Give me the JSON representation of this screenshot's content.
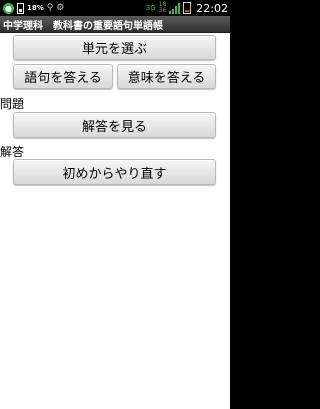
{
  "status_bar": {
    "left_icons": [
      "app-icon",
      "battery-small-icon",
      "usb-icon",
      "android-debug-icon"
    ],
    "battery_small_percent": "18%",
    "network_label": "3G",
    "signal_level_top": "18",
    "signal_level_bottom": "36",
    "time": "22:02"
  },
  "title": "中学理科　教科書の重要語句単語帳",
  "buttons": {
    "select_unit": "単元を選ぶ",
    "answer_term": "語句を答える",
    "answer_meaning": "意味を答える",
    "show_answer": "解答を見る",
    "restart": "初めからやり直す"
  },
  "labels": {
    "question": "問題",
    "answer": "解答"
  }
}
